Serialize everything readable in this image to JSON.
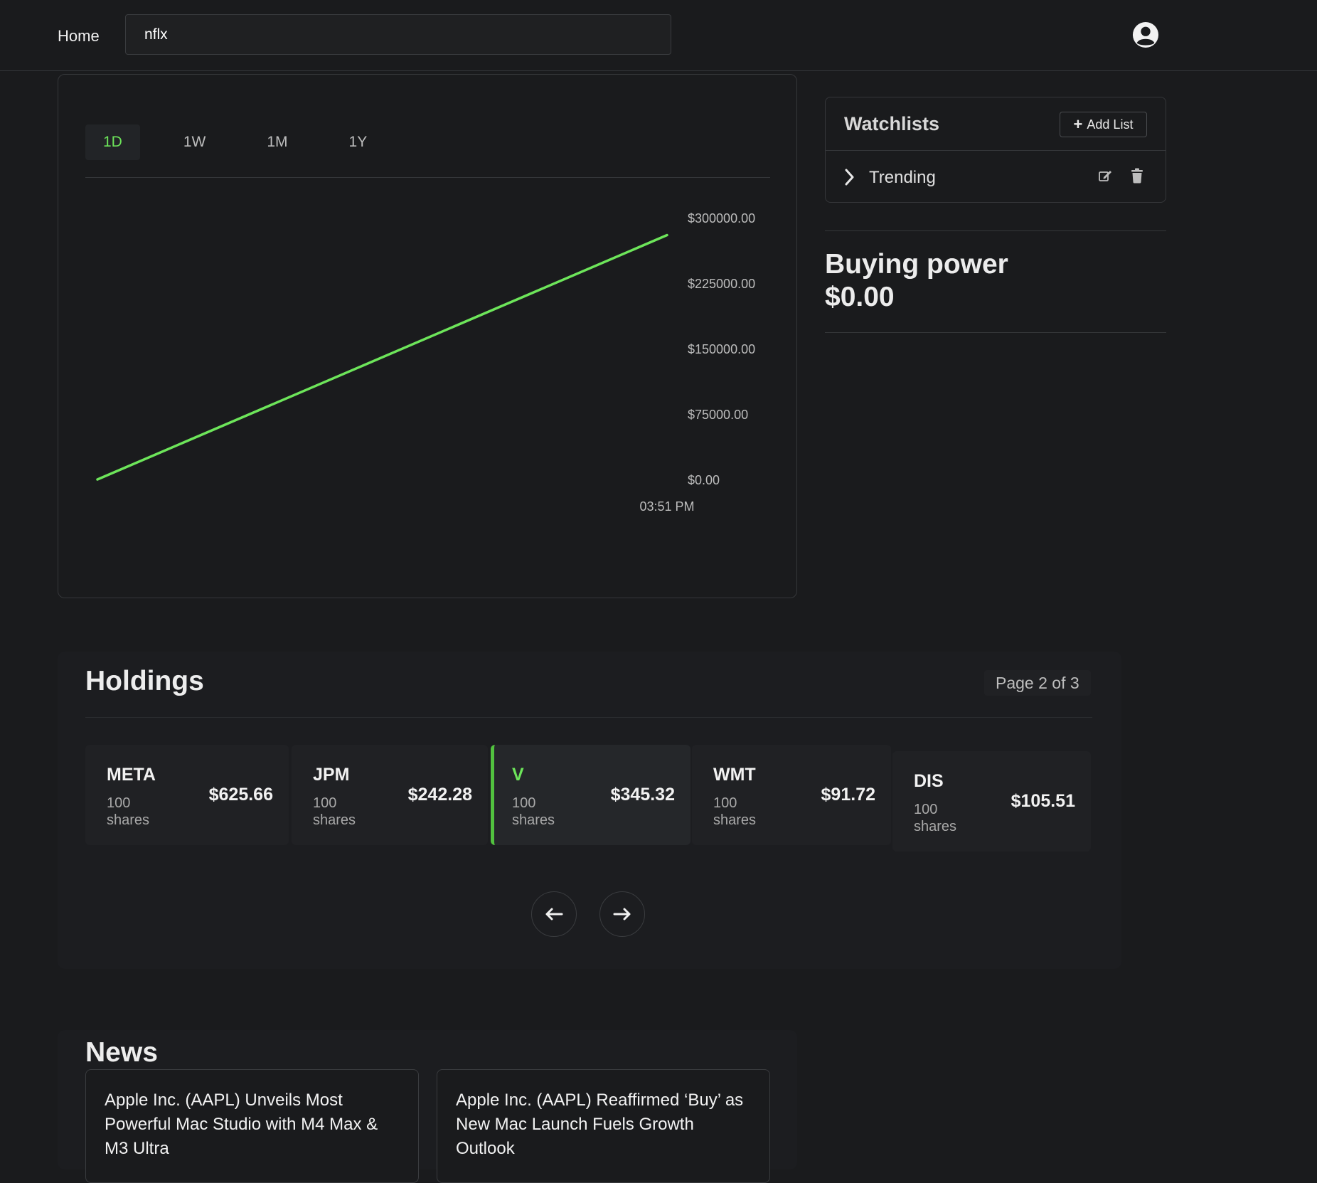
{
  "topbar": {
    "home_label": "Home",
    "search_value": "nflx",
    "profile_icon": "user-circle-icon"
  },
  "chart": {
    "range_tabs": [
      "1D",
      "1W",
      "1M",
      "1Y"
    ],
    "active_tab": "1D",
    "line_color": "#6de55a"
  },
  "chart_data": {
    "type": "line",
    "x": [
      "",
      "03:51 PM"
    ],
    "y": [
      0,
      280000
    ],
    "x_tick_labels": [
      "03:51 PM"
    ],
    "y_tick_labels": [
      "$300000.00",
      "$225000.00",
      "$150000.00",
      "$75000.00",
      "$0.00"
    ],
    "ylim": [
      0,
      300000
    ],
    "grid": false
  },
  "watchlists": {
    "title": "Watchlists",
    "add_label": "Add List",
    "items": [
      {
        "name": "Trending"
      }
    ]
  },
  "buying_power": {
    "label": "Buying power",
    "value": "$0.00"
  },
  "holdings": {
    "title": "Holdings",
    "page_indicator": "Page 2 of 3",
    "items": [
      {
        "symbol": "META",
        "qty": "100",
        "unit": "shares",
        "price": "$625.66"
      },
      {
        "symbol": "JPM",
        "qty": "100",
        "unit": "shares",
        "price": "$242.28"
      },
      {
        "symbol": "V",
        "qty": "100",
        "unit": "shares",
        "price": "$345.32"
      },
      {
        "symbol": "WMT",
        "qty": "100",
        "unit": "shares",
        "price": "$91.72"
      },
      {
        "symbol": "DIS",
        "qty": "100",
        "unit": "shares",
        "price": "$105.51"
      }
    ],
    "active_symbol": "V",
    "prev_icon": "arrow-left-icon",
    "next_icon": "arrow-right-icon"
  },
  "news": {
    "title": "News",
    "items": [
      {
        "headline": "Apple Inc. (AAPL) Unveils Most Powerful Mac Studio with M4 Max & M3 Ultra"
      },
      {
        "headline": "Apple Inc. (AAPL) Reaffirmed ‘Buy’ as New Mac Launch Fuels Growth Outlook"
      }
    ]
  }
}
